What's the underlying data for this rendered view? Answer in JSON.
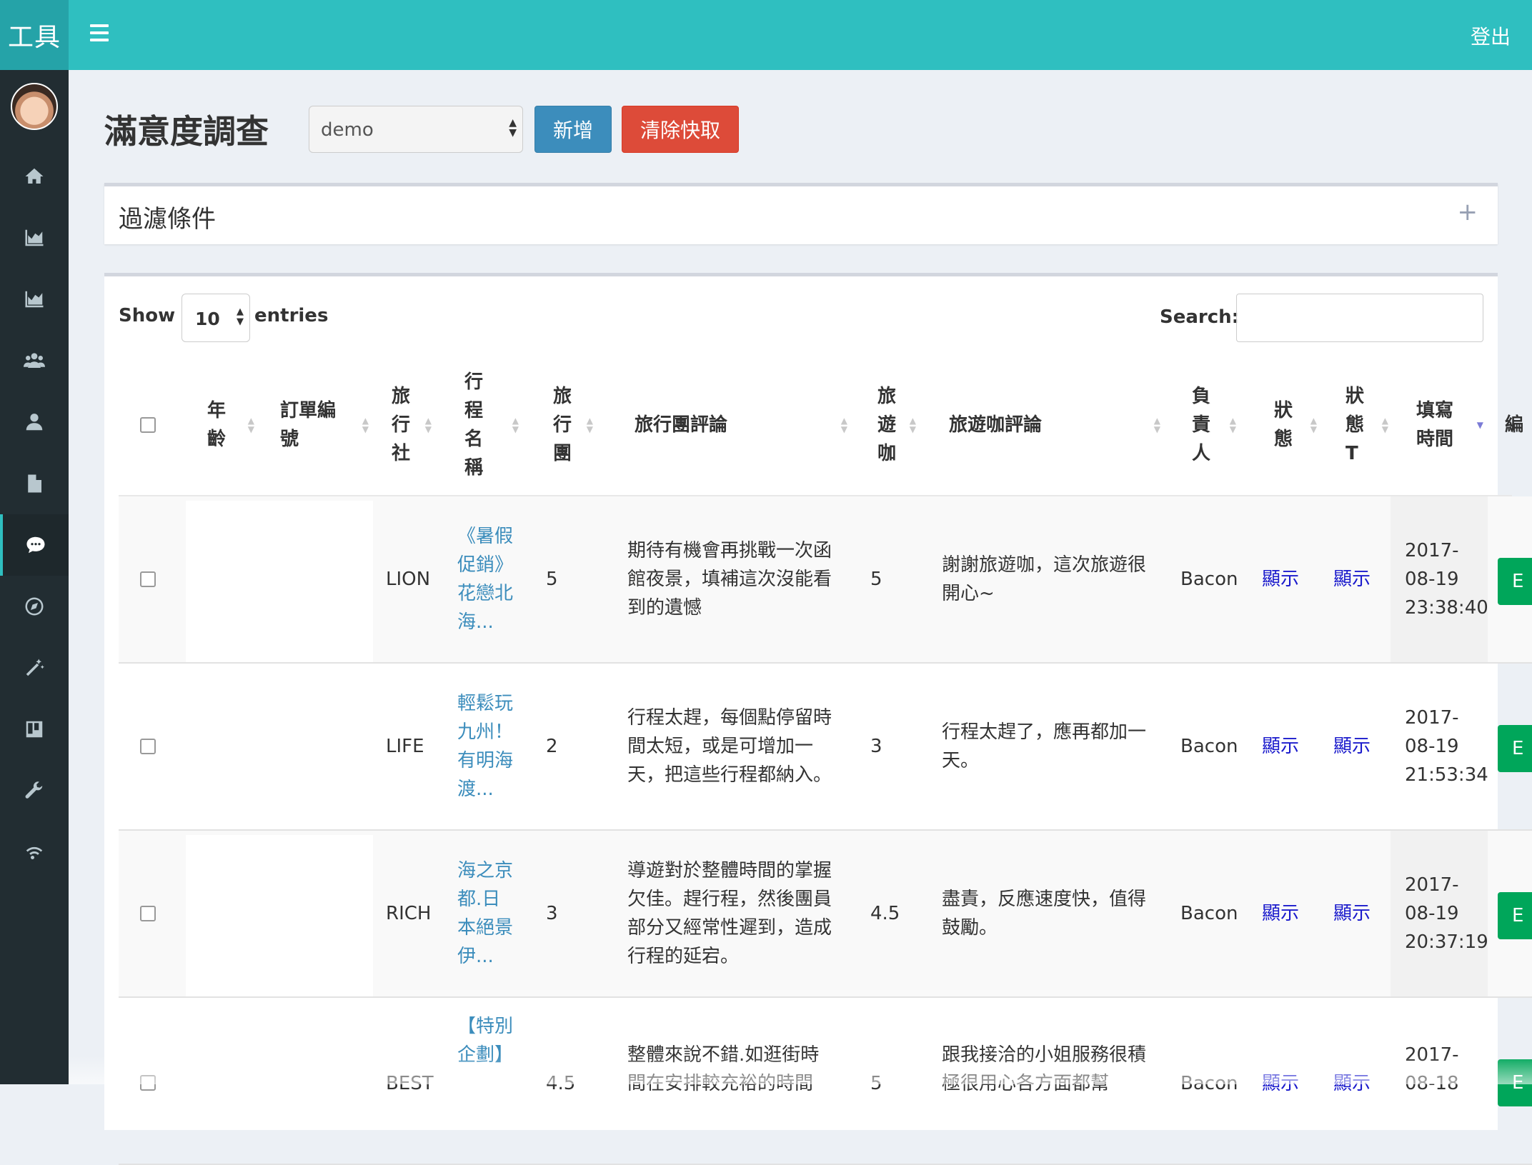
{
  "app": {
    "logo": "工具",
    "logout": "登出"
  },
  "sidebar": {
    "items": [
      {
        "icon": "home-icon"
      },
      {
        "icon": "area-chart-icon"
      },
      {
        "icon": "area-chart-icon"
      },
      {
        "icon": "users-icon"
      },
      {
        "icon": "user-icon"
      },
      {
        "icon": "file-icon"
      },
      {
        "icon": "comment-icon",
        "active": true
      },
      {
        "icon": "compass-icon"
      },
      {
        "icon": "magic-wand-icon"
      },
      {
        "icon": "trello-icon"
      },
      {
        "icon": "wrench-icon"
      },
      {
        "icon": "wifi-icon"
      }
    ]
  },
  "header": {
    "title": "滿意度調查",
    "select_value": "demo",
    "add_label": "新增",
    "clear_label": "清除快取"
  },
  "filter": {
    "title": "過濾條件",
    "toggle": "+"
  },
  "table": {
    "show_label": "Show",
    "length_value": "10",
    "entries_label": "entries",
    "search_label": "Search:",
    "columns": [
      "年齡",
      "訂單編號",
      "旅行社",
      "行程名稱",
      "旅行團",
      "旅行團評論",
      "旅遊咖",
      "旅遊咖評論",
      "負責人",
      "狀態",
      "狀態T",
      "填寫時間",
      "編"
    ],
    "rows": [
      {
        "age": "",
        "order": "",
        "agency": "LION",
        "trip": "《暑假促銷》花戀北海...",
        "tour_score": "5",
        "tour_comment": "期待有機會再挑戰一次函館夜景，填補這次沒能看到的遺憾",
        "guide_score": "5",
        "guide_comment": "謝謝旅遊咖，這次旅遊很開心~",
        "owner": "Bacon",
        "status": "顯示",
        "status_t": "顯示",
        "time": "2017-08-19 23:38:40",
        "action": "E"
      },
      {
        "age": "",
        "order": "",
        "agency": "LIFE",
        "trip": "輕鬆玩九州！有明海渡...",
        "tour_score": "2",
        "tour_comment": "行程太趕，每個點停留時間太短，或是可增加一天，把這些行程都納入。",
        "guide_score": "3",
        "guide_comment": "行程太趕了，應再都加一天。",
        "owner": "Bacon",
        "status": "顯示",
        "status_t": "顯示",
        "time": "2017-08-19 21:53:34",
        "action": "E"
      },
      {
        "age": "",
        "order": "",
        "agency": "RICH",
        "trip": "海之京都.日本絕景伊...",
        "tour_score": "3",
        "tour_comment": "導遊對於整體時間的掌握欠佳。趕行程，然後團員部分又經常性遲到，造成行程的延宕。",
        "guide_score": "4.5",
        "guide_comment": "盡責，反應速度快，值得鼓勵。",
        "owner": "Bacon",
        "status": "顯示",
        "status_t": "顯示",
        "time": "2017-08-19 20:37:19",
        "action": "E"
      },
      {
        "age": "",
        "order": "",
        "agency": "BEST",
        "trip": "【特別企劃】",
        "tour_score": "4.5",
        "tour_comment": "整體來說不錯.如逛街時間在安排較充裕的時間",
        "guide_score": "5",
        "guide_comment": "跟我接洽的小姐服務很積極很用心各方面都幫",
        "owner": "Bacon",
        "status": "顯示",
        "status_t": "顯示",
        "time": "2017-08-18",
        "action": "E"
      }
    ]
  }
}
